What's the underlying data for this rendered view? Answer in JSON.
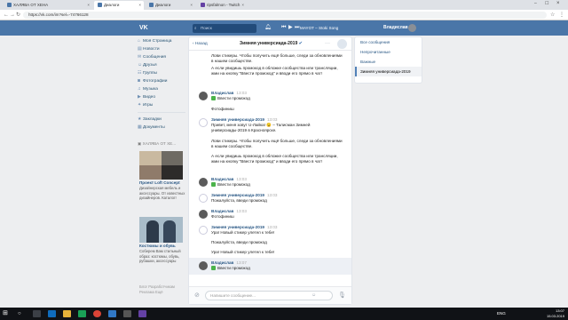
{
  "browser": {
    "tabs": [
      {
        "label": "ХАЛЯВА ОТ ХЕНА",
        "color": "#4a76a8"
      },
      {
        "label": "Диалоги",
        "color": "#4a76a8"
      },
      {
        "label": "Диалоги",
        "color": "#4a76a8"
      },
      {
        "label": "ripsfalmon - Twitch",
        "color": "#6441a4"
      }
    ],
    "url": "https://vk.com/im?sel=-74766128"
  },
  "vk": {
    "search_placeholder": "Поиск",
    "player_text": "MAYOT – Stoki Song",
    "user_name": "Владислав"
  },
  "left_menu": {
    "items": [
      "Моя Страница",
      "Новости",
      "Сообщения",
      "Друзья",
      "Группы",
      "Фотографии",
      "Музыка",
      "Видео",
      "Игры"
    ],
    "items2": [
      "Закладки",
      "Документы"
    ],
    "ad_header": "ХАЛЯВА ОТ ХЕ...",
    "ad1_title": "Проект Loft Concept",
    "ad1_text": "Дизайнерская мебель и аксессуары. От известных дизайнеров. Каталог!",
    "ad2_title": "Костюмы и обувь",
    "ad2_text": "Соберем Вам стильный образ: костюмы, обувь, рубашки, аксессуары",
    "footer": "Блог   Разработчикам   Реклама   Ещё"
  },
  "chat": {
    "back_label": "Назад",
    "title": "Зимняя универсиада-2019",
    "input_placeholder": "Напишите сообщение...",
    "messages": [
      {
        "name": "",
        "time": "",
        "text": "Лови стикеры. Чтобы получить ещё больше, следи за обновлениями в нашем сообществе."
      },
      {
        "name": "",
        "time": "",
        "text": "А если увидишь промокод в обложке сообщества или трансляции, жми на кнопку \"Ввести промокод\" и вводи его прямо в чат!"
      },
      {
        "name": "Владислав",
        "time": "13:03",
        "text": "Ввести промокод"
      },
      {
        "name": "",
        "time": "",
        "text": "Фотофиниш"
      },
      {
        "name": "Зимняя универсиада-2019",
        "time": "13:03",
        "text": "Привет, меня зовут U-Лайка! 😉 – Талисман Зимней универсиады-2019 в Красноярске."
      },
      {
        "name": "",
        "time": "",
        "text": "Лови стикеры. Чтобы получить ещё больше, следи за обновлениями в нашем сообществе."
      },
      {
        "name": "",
        "time": "",
        "text": "А если увидишь промокод в обложке сообщества или трансляции, жми на кнопку \"Ввести промокод\" и вводи его прямо в чат!"
      },
      {
        "name": "Владислав",
        "time": "13:03",
        "text": "Ввести промокод"
      },
      {
        "name": "Зимняя универсиада-2019",
        "time": "13:03",
        "text": "Пожалуйста, введи промокод"
      },
      {
        "name": "Владислав",
        "time": "13:03",
        "text": "Фотофиниш"
      },
      {
        "name": "Зимняя универсиада-2019",
        "time": "13:03",
        "text": "Ура! Новый стикер улетел к тебе!"
      },
      {
        "name": "",
        "time": "",
        "text": "Пожалуйста, введи промокод"
      },
      {
        "name": "",
        "time": "",
        "text": "Ура! Новый стикер улетел к тебе!"
      },
      {
        "name": "Владислав",
        "time": "13:07",
        "text": "Ввести промокод"
      }
    ]
  },
  "right_nav": {
    "items": [
      "Все сообщения",
      "Непрочитанные",
      "Важные",
      "Зимняя универсиада-2019"
    ]
  },
  "taskbar": {
    "time": "13:07",
    "date": "15.03.2019",
    "lang": "ENG"
  }
}
